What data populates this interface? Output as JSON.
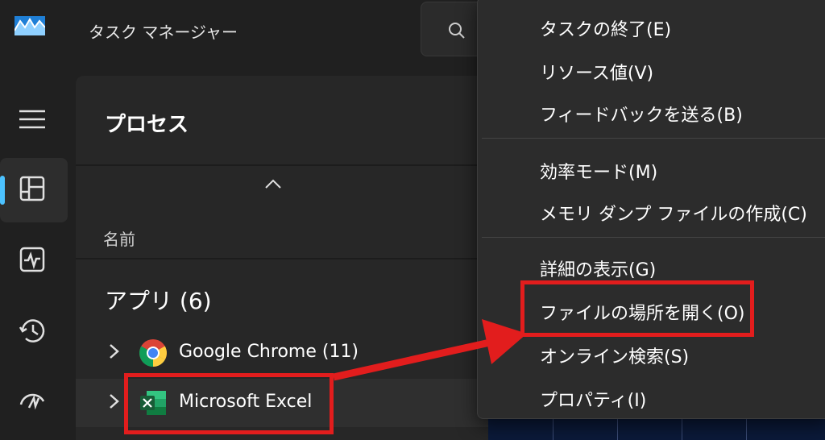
{
  "app": {
    "title": "タスク マネージャー",
    "logo_icon": "task-manager-logo"
  },
  "search": {
    "icon": "search-icon"
  },
  "nav": [
    {
      "name": "hamburger-menu",
      "icon": "hamburger-icon"
    },
    {
      "name": "processes",
      "icon": "processes-icon",
      "active": true
    },
    {
      "name": "performance",
      "icon": "performance-icon"
    },
    {
      "name": "app-history",
      "icon": "history-icon"
    },
    {
      "name": "startup-apps",
      "icon": "startup-icon"
    }
  ],
  "main": {
    "title": "プロセス",
    "column_name": "名前",
    "group_title": "アプリ (6)",
    "rows": [
      {
        "label": "Google Chrome (11)",
        "icon": "chrome-icon"
      },
      {
        "label": "Microsoft Excel",
        "icon": "excel-icon",
        "selected": true
      }
    ]
  },
  "context_menu": {
    "items": [
      "タスクの終了(E)",
      "リソース値(V)",
      "フィードバックを送る(B)",
      "効率モード(M)",
      "メモリ ダンプ ファイルの作成(C)",
      "詳細の表示(G)",
      "ファイルの場所を開く(O)",
      "オンライン検索(S)",
      "プロパティ(I)"
    ],
    "highlighted_index": 6
  },
  "annotation": {
    "color": "#e21d1d"
  }
}
